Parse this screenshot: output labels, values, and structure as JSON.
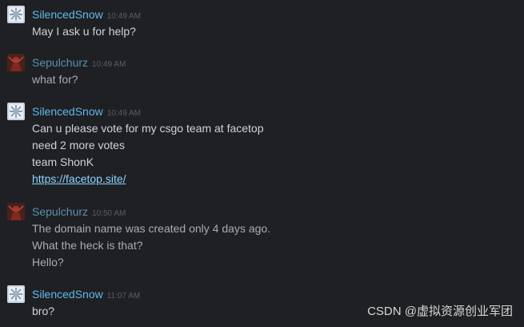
{
  "messages": [
    {
      "sender": "SilencedSnow",
      "time": "10:49 AM",
      "lines": [
        "May I ask u for help?"
      ]
    },
    {
      "sender": "Sepulchurz",
      "time": "10:49 AM",
      "lines": [
        "what for?"
      ]
    },
    {
      "sender": "SilencedSnow",
      "time": "10:49 AM",
      "lines": [
        "Can u please vote for my csgo team at facetop",
        "need 2 more votes",
        "team ShonK"
      ],
      "link": "https://facetop.site/"
    },
    {
      "sender": "Sepulchurz",
      "time": "10:50 AM",
      "lines": [
        "The domain name was created only 4 days ago.",
        "What the heck is that?",
        "Hello?"
      ]
    },
    {
      "sender": "SilencedSnow",
      "time": "11:07 AM",
      "lines": [
        "bro?"
      ]
    }
  ],
  "watermark": "CSDN @虚拟资源创业军团",
  "colors": {
    "background": "#1e2024",
    "name_accent": "#62b9e8",
    "link": "#8fd3ff",
    "timestamp": "#5a5e66",
    "text": "#d0d3d7"
  },
  "icons": {
    "silencedsnow_avatar": "snowflake-avatar-icon",
    "sepulchurz_avatar": "red-figure-avatar-icon"
  }
}
